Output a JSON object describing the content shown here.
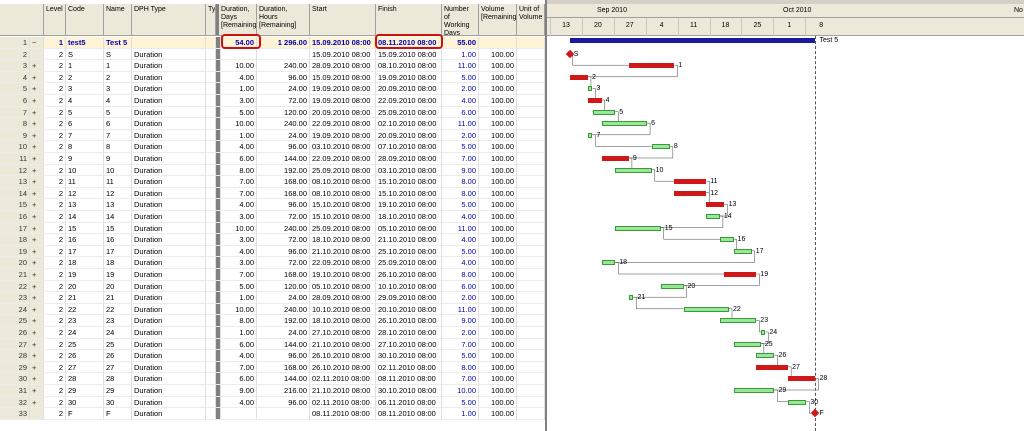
{
  "columns": {
    "level": "Level",
    "code": "Code",
    "name": "Name",
    "type": "DPH Type",
    "ty": "Ty",
    "dur_days": "Duration, Days [Remaining]",
    "dur_hours": "Duration, Hours [Remaining]",
    "start": "Start",
    "finish": "Finish",
    "working": "Number of Working Days",
    "volume": "Volume [Remaining]",
    "unit": "Unit of Volume"
  },
  "rows": [
    {
      "num": "1",
      "exp": "−",
      "level": "1",
      "code": "test5",
      "name": "Test 5",
      "type": "",
      "days": "54.00",
      "hours": "1 296.00",
      "start": "15.09.2010 08:00",
      "finish": "08.11.2010 08:00",
      "work": "55.00",
      "vol": ""
    },
    {
      "num": "2",
      "exp": "",
      "level": "2",
      "code": "S",
      "name": "S",
      "type": "Duration",
      "days": "",
      "hours": "",
      "start": "15.09.2010 08:00",
      "finish": "15.09.2010 08:00",
      "work": "1.00",
      "vol": "100.00"
    },
    {
      "num": "3",
      "exp": "+",
      "level": "2",
      "code": "1",
      "name": "1",
      "type": "Duration",
      "days": "10.00",
      "hours": "240.00",
      "start": "28.09.2010 08:00",
      "finish": "08.10.2010 08:00",
      "work": "11.00",
      "vol": "100.00"
    },
    {
      "num": "4",
      "exp": "+",
      "level": "2",
      "code": "2",
      "name": "2",
      "type": "Duration",
      "days": "4.00",
      "hours": "96.00",
      "start": "15.09.2010 08:00",
      "finish": "19.09.2010 08:00",
      "work": "5.00",
      "vol": "100.00"
    },
    {
      "num": "5",
      "exp": "+",
      "level": "2",
      "code": "3",
      "name": "3",
      "type": "Duration",
      "days": "1.00",
      "hours": "24.00",
      "start": "19.09.2010 08:00",
      "finish": "20.09.2010 08:00",
      "work": "2.00",
      "vol": "100.00"
    },
    {
      "num": "6",
      "exp": "+",
      "level": "2",
      "code": "4",
      "name": "4",
      "type": "Duration",
      "days": "3.00",
      "hours": "72.00",
      "start": "19.09.2010 08:00",
      "finish": "22.09.2010 08:00",
      "work": "4.00",
      "vol": "100.00"
    },
    {
      "num": "7",
      "exp": "+",
      "level": "2",
      "code": "5",
      "name": "5",
      "type": "Duration",
      "days": "5.00",
      "hours": "120.00",
      "start": "20.09.2010 08:00",
      "finish": "25.09.2010 08:00",
      "work": "6.00",
      "vol": "100.00"
    },
    {
      "num": "8",
      "exp": "+",
      "level": "2",
      "code": "6",
      "name": "6",
      "type": "Duration",
      "days": "10.00",
      "hours": "240.00",
      "start": "22.09.2010 08:00",
      "finish": "02.10.2010 08:00",
      "work": "11.00",
      "vol": "100.00"
    },
    {
      "num": "9",
      "exp": "+",
      "level": "2",
      "code": "7",
      "name": "7",
      "type": "Duration",
      "days": "1.00",
      "hours": "24.00",
      "start": "19.09.2010 08:00",
      "finish": "20.09.2010 08:00",
      "work": "2.00",
      "vol": "100.00"
    },
    {
      "num": "10",
      "exp": "+",
      "level": "2",
      "code": "8",
      "name": "8",
      "type": "Duration",
      "days": "4.00",
      "hours": "96.00",
      "start": "03.10.2010 08:00",
      "finish": "07.10.2010 08:00",
      "work": "5.00",
      "vol": "100.00"
    },
    {
      "num": "11",
      "exp": "+",
      "level": "2",
      "code": "9",
      "name": "9",
      "type": "Duration",
      "days": "6.00",
      "hours": "144.00",
      "start": "22.09.2010 08:00",
      "finish": "28.09.2010 08:00",
      "work": "7.00",
      "vol": "100.00"
    },
    {
      "num": "12",
      "exp": "+",
      "level": "2",
      "code": "10",
      "name": "10",
      "type": "Duration",
      "days": "8.00",
      "hours": "192.00",
      "start": "25.09.2010 08:00",
      "finish": "03.10.2010 08:00",
      "work": "9.00",
      "vol": "100.00"
    },
    {
      "num": "13",
      "exp": "+",
      "level": "2",
      "code": "11",
      "name": "11",
      "type": "Duration",
      "days": "7.00",
      "hours": "168.00",
      "start": "08.10.2010 08:00",
      "finish": "15.10.2010 08:00",
      "work": "8.00",
      "vol": "100.00"
    },
    {
      "num": "14",
      "exp": "+",
      "level": "2",
      "code": "12",
      "name": "12",
      "type": "Duration",
      "days": "7.00",
      "hours": "168.00",
      "start": "08.10.2010 08:00",
      "finish": "15.10.2010 08:00",
      "work": "8.00",
      "vol": "100.00"
    },
    {
      "num": "15",
      "exp": "+",
      "level": "2",
      "code": "13",
      "name": "13",
      "type": "Duration",
      "days": "4.00",
      "hours": "96.00",
      "start": "15.10.2010 08:00",
      "finish": "19.10.2010 08:00",
      "work": "5.00",
      "vol": "100.00"
    },
    {
      "num": "16",
      "exp": "+",
      "level": "2",
      "code": "14",
      "name": "14",
      "type": "Duration",
      "days": "3.00",
      "hours": "72.00",
      "start": "15.10.2010 08:00",
      "finish": "18.10.2010 08:00",
      "work": "4.00",
      "vol": "100.00"
    },
    {
      "num": "17",
      "exp": "+",
      "level": "2",
      "code": "15",
      "name": "15",
      "type": "Duration",
      "days": "10.00",
      "hours": "240.00",
      "start": "25.09.2010 08:00",
      "finish": "05.10.2010 08:00",
      "work": "11.00",
      "vol": "100.00"
    },
    {
      "num": "18",
      "exp": "+",
      "level": "2",
      "code": "16",
      "name": "16",
      "type": "Duration",
      "days": "3.00",
      "hours": "72.00",
      "start": "18.10.2010 08:00",
      "finish": "21.10.2010 08:00",
      "work": "4.00",
      "vol": "100.00"
    },
    {
      "num": "19",
      "exp": "+",
      "level": "2",
      "code": "17",
      "name": "17",
      "type": "Duration",
      "days": "4.00",
      "hours": "96.00",
      "start": "21.10.2010 08:00",
      "finish": "25.10.2010 08:00",
      "work": "5.00",
      "vol": "100.00"
    },
    {
      "num": "20",
      "exp": "+",
      "level": "2",
      "code": "18",
      "name": "18",
      "type": "Duration",
      "days": "3.00",
      "hours": "72.00",
      "start": "22.09.2010 08:00",
      "finish": "25.09.2010 08:00",
      "work": "4.00",
      "vol": "100.00"
    },
    {
      "num": "21",
      "exp": "+",
      "level": "2",
      "code": "19",
      "name": "19",
      "type": "Duration",
      "days": "7.00",
      "hours": "168.00",
      "start": "19.10.2010 08:00",
      "finish": "26.10.2010 08:00",
      "work": "8.00",
      "vol": "100.00"
    },
    {
      "num": "22",
      "exp": "+",
      "level": "2",
      "code": "20",
      "name": "20",
      "type": "Duration",
      "days": "5.00",
      "hours": "120.00",
      "start": "05.10.2010 08:00",
      "finish": "10.10.2010 08:00",
      "work": "6.00",
      "vol": "100.00"
    },
    {
      "num": "23",
      "exp": "+",
      "level": "2",
      "code": "21",
      "name": "21",
      "type": "Duration",
      "days": "1.00",
      "hours": "24.00",
      "start": "28.09.2010 08:00",
      "finish": "29.09.2010 08:00",
      "work": "2.00",
      "vol": "100.00"
    },
    {
      "num": "24",
      "exp": "+",
      "level": "2",
      "code": "22",
      "name": "22",
      "type": "Duration",
      "days": "10.00",
      "hours": "240.00",
      "start": "10.10.2010 08:00",
      "finish": "20.10.2010 08:00",
      "work": "11.00",
      "vol": "100.00"
    },
    {
      "num": "25",
      "exp": "+",
      "level": "2",
      "code": "23",
      "name": "23",
      "type": "Duration",
      "days": "8.00",
      "hours": "192.00",
      "start": "18.10.2010 08:00",
      "finish": "26.10.2010 08:00",
      "work": "9.00",
      "vol": "100.00"
    },
    {
      "num": "26",
      "exp": "+",
      "level": "2",
      "code": "24",
      "name": "24",
      "type": "Duration",
      "days": "1.00",
      "hours": "24.00",
      "start": "27.10.2010 08:00",
      "finish": "28.10.2010 08:00",
      "work": "2.00",
      "vol": "100.00"
    },
    {
      "num": "27",
      "exp": "+",
      "level": "2",
      "code": "25",
      "name": "25",
      "type": "Duration",
      "days": "6.00",
      "hours": "144.00",
      "start": "21.10.2010 08:00",
      "finish": "27.10.2010 08:00",
      "work": "7.00",
      "vol": "100.00"
    },
    {
      "num": "28",
      "exp": "+",
      "level": "2",
      "code": "26",
      "name": "26",
      "type": "Duration",
      "days": "4.00",
      "hours": "96.00",
      "start": "26.10.2010 08:00",
      "finish": "30.10.2010 08:00",
      "work": "5.00",
      "vol": "100.00"
    },
    {
      "num": "29",
      "exp": "+",
      "level": "2",
      "code": "27",
      "name": "27",
      "type": "Duration",
      "days": "7.00",
      "hours": "168.00",
      "start": "26.10.2010 08:00",
      "finish": "02.11.2010 08:00",
      "work": "8.00",
      "vol": "100.00"
    },
    {
      "num": "30",
      "exp": "+",
      "level": "2",
      "code": "28",
      "name": "28",
      "type": "Duration",
      "days": "6.00",
      "hours": "144.00",
      "start": "02.11.2010 08:00",
      "finish": "08.11.2010 08:00",
      "work": "7.00",
      "vol": "100.00"
    },
    {
      "num": "31",
      "exp": "+",
      "level": "2",
      "code": "29",
      "name": "29",
      "type": "Duration",
      "days": "9.00",
      "hours": "216.00",
      "start": "21.10.2010 08:00",
      "finish": "30.10.2010 08:00",
      "work": "10.00",
      "vol": "100.00"
    },
    {
      "num": "32",
      "exp": "+",
      "level": "2",
      "code": "30",
      "name": "30",
      "type": "Duration",
      "days": "4.00",
      "hours": "96.00",
      "start": "02.11.2010 08:00",
      "finish": "06.11.2010 08:00",
      "work": "5.00",
      "vol": "100.00"
    },
    {
      "num": "33",
      "exp": "",
      "level": "2",
      "code": "F",
      "name": "F",
      "type": "Duration",
      "days": "",
      "hours": "",
      "start": "08.11.2010 08:00",
      "finish": "08.11.2010 08:00",
      "work": "1.00",
      "vol": "100.00"
    }
  ],
  "gantt": {
    "months": [
      "Sep 2010",
      "Oct 2010",
      "No"
    ],
    "days": [
      "13",
      "20",
      "27",
      "4",
      "11",
      "18",
      "25",
      "1",
      "8"
    ],
    "summary_label": "Test 5",
    "colors": {
      "critical": "#d01818",
      "normal": "#98e898",
      "summary": "#1a1a9c",
      "milestone": "#d01818"
    },
    "tasks": [
      {
        "label": "S",
        "start": "2010-09-15",
        "finish": "2010-09-15",
        "row": 1,
        "kind": "milestone"
      },
      {
        "label": "1",
        "start": "2010-09-28",
        "finish": "2010-10-08",
        "row": 2,
        "kind": "critical"
      },
      {
        "label": "2",
        "start": "2010-09-15",
        "finish": "2010-09-19",
        "row": 3,
        "kind": "critical"
      },
      {
        "label": "3",
        "start": "2010-09-19",
        "finish": "2010-09-20",
        "row": 4,
        "kind": "normal"
      },
      {
        "label": "4",
        "start": "2010-09-19",
        "finish": "2010-09-22",
        "row": 5,
        "kind": "critical"
      },
      {
        "label": "5",
        "start": "2010-09-20",
        "finish": "2010-09-25",
        "row": 6,
        "kind": "normal"
      },
      {
        "label": "6",
        "start": "2010-09-22",
        "finish": "2010-10-02",
        "row": 7,
        "kind": "normal"
      },
      {
        "label": "7",
        "start": "2010-09-19",
        "finish": "2010-09-20",
        "row": 8,
        "kind": "normal"
      },
      {
        "label": "8",
        "start": "2010-10-03",
        "finish": "2010-10-07",
        "row": 9,
        "kind": "normal"
      },
      {
        "label": "9",
        "start": "2010-09-22",
        "finish": "2010-09-28",
        "row": 10,
        "kind": "critical"
      },
      {
        "label": "10",
        "start": "2010-09-25",
        "finish": "2010-10-03",
        "row": 11,
        "kind": "normal"
      },
      {
        "label": "11",
        "start": "2010-10-08",
        "finish": "2010-10-15",
        "row": 12,
        "kind": "critical"
      },
      {
        "label": "12",
        "start": "2010-10-08",
        "finish": "2010-10-15",
        "row": 13,
        "kind": "critical"
      },
      {
        "label": "13",
        "start": "2010-10-15",
        "finish": "2010-10-19",
        "row": 14,
        "kind": "critical"
      },
      {
        "label": "14",
        "start": "2010-10-15",
        "finish": "2010-10-18",
        "row": 15,
        "kind": "normal"
      },
      {
        "label": "15",
        "start": "2010-09-25",
        "finish": "2010-10-05",
        "row": 16,
        "kind": "normal"
      },
      {
        "label": "16",
        "start": "2010-10-18",
        "finish": "2010-10-21",
        "row": 17,
        "kind": "normal"
      },
      {
        "label": "17",
        "start": "2010-10-21",
        "finish": "2010-10-25",
        "row": 18,
        "kind": "normal"
      },
      {
        "label": "18",
        "start": "2010-09-22",
        "finish": "2010-09-25",
        "row": 19,
        "kind": "normal"
      },
      {
        "label": "19",
        "start": "2010-10-19",
        "finish": "2010-10-26",
        "row": 20,
        "kind": "critical"
      },
      {
        "label": "20",
        "start": "2010-10-05",
        "finish": "2010-10-10",
        "row": 21,
        "kind": "normal"
      },
      {
        "label": "21",
        "start": "2010-09-28",
        "finish": "2010-09-29",
        "row": 22,
        "kind": "normal"
      },
      {
        "label": "22",
        "start": "2010-10-10",
        "finish": "2010-10-20",
        "row": 23,
        "kind": "normal"
      },
      {
        "label": "23",
        "start": "2010-10-18",
        "finish": "2010-10-26",
        "row": 24,
        "kind": "normal"
      },
      {
        "label": "24",
        "start": "2010-10-27",
        "finish": "2010-10-28",
        "row": 25,
        "kind": "normal"
      },
      {
        "label": "25",
        "start": "2010-10-21",
        "finish": "2010-10-27",
        "row": 26,
        "kind": "normal"
      },
      {
        "label": "26",
        "start": "2010-10-26",
        "finish": "2010-10-30",
        "row": 27,
        "kind": "normal"
      },
      {
        "label": "27",
        "start": "2010-10-26",
        "finish": "2010-11-02",
        "row": 28,
        "kind": "critical"
      },
      {
        "label": "28",
        "start": "2010-11-02",
        "finish": "2010-11-08",
        "row": 29,
        "kind": "critical"
      },
      {
        "label": "29",
        "start": "2010-10-21",
        "finish": "2010-10-30",
        "row": 30,
        "kind": "normal"
      },
      {
        "label": "30",
        "start": "2010-11-02",
        "finish": "2010-11-06",
        "row": 31,
        "kind": "normal"
      },
      {
        "label": "F",
        "start": "2010-11-08",
        "finish": "2010-11-08",
        "row": 32,
        "kind": "milestone"
      }
    ]
  }
}
